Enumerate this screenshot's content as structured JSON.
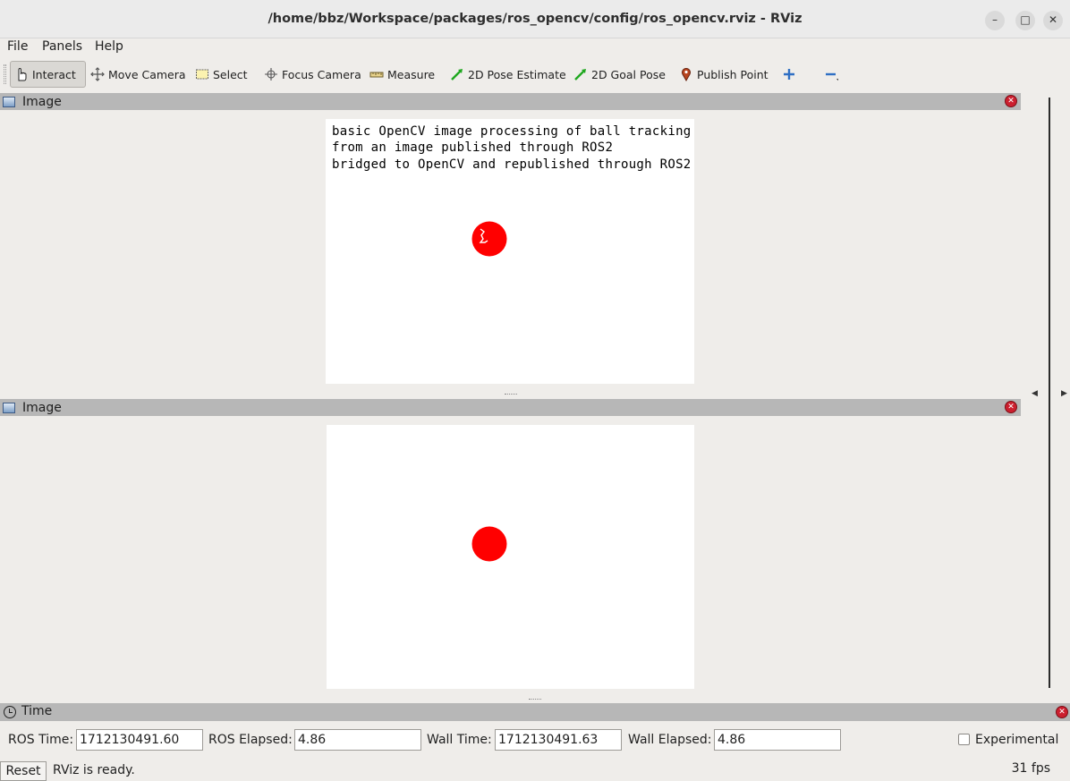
{
  "window": {
    "title": "/home/bbz/Workspace/packages/ros_opencv/config/ros_opencv.rviz - RViz",
    "buttons": [
      "minimize",
      "maximize",
      "close"
    ]
  },
  "menu": {
    "file": "File",
    "panels": "Panels",
    "help": "Help"
  },
  "toolbar": {
    "interact": "Interact",
    "move_camera": "Move Camera",
    "select": "Select",
    "focus_camera": "Focus Camera",
    "measure": "Measure",
    "pose_estimate": "2D Pose Estimate",
    "goal_pose": "2D Goal Pose",
    "publish_point": "Publish Point"
  },
  "panels": {
    "top": {
      "title": "Image",
      "overlay": [
        "basic OpenCV image processing of ball tracking",
        "from an image published through ROS2",
        "bridged to OpenCV and republished through ROS2"
      ]
    },
    "bottom": {
      "title": "Image"
    }
  },
  "time": {
    "title": "Time",
    "ros_time_label": "ROS Time:",
    "ros_time": "1712130491.60",
    "ros_elapsed_label": "ROS Elapsed:",
    "ros_elapsed": "4.86",
    "wall_time_label": "Wall Time:",
    "wall_time": "1712130491.63",
    "wall_elapsed_label": "Wall Elapsed:",
    "wall_elapsed": "4.86",
    "experimental_label": "Experimental"
  },
  "status": {
    "reset_label": "Reset",
    "message": "RViz is ready.",
    "fps": "31 fps"
  },
  "colors": {
    "ball": "#ff0000",
    "header_bg": "#b7b7b7",
    "close_red": "#cc1f2f"
  }
}
